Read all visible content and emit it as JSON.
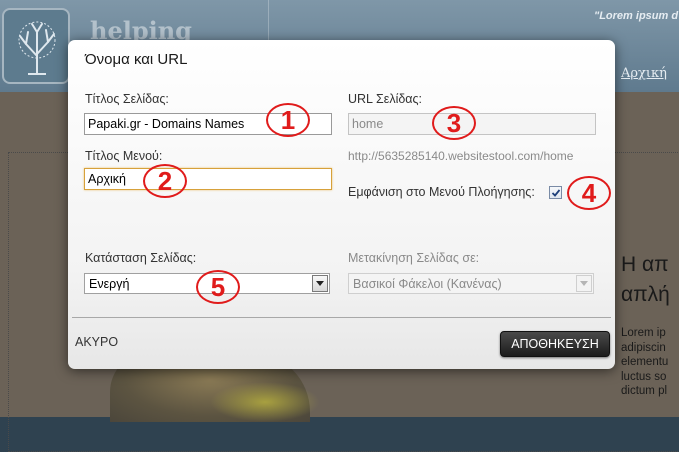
{
  "site": {
    "brand": "helping",
    "tagline": "\"Lorem ipsum d",
    "nav_link": "Αρχική",
    "heading_lines": [
      "Η απ",
      "απλή"
    ],
    "text_lines": [
      "Lorem ip",
      "adipiscin",
      "elementu",
      "luctus so",
      "dictum pl"
    ]
  },
  "dialog": {
    "title": "Όνομα και URL",
    "page_title_label": "Τίτλος Σελίδας:",
    "page_title_value": "Papaki.gr - Domains Names",
    "menu_title_label": "Τίτλος Μενού:",
    "menu_title_value": "Αρχική",
    "url_label": "URL Σελίδας:",
    "url_value": "home",
    "url_preview": "http://5635285140.websitestool.com/home",
    "show_in_menu_label": "Εμφάνιση στο Μενού Πλοήγησης:",
    "show_in_menu_checked": true,
    "status_label": "Κατάσταση Σελίδας:",
    "status_value": "Ενεργή",
    "move_label": "Μετακίνηση Σελίδας σε:",
    "move_value": "Βασικοί Φάκελοι (Κανένας)",
    "cancel_label": "ΑΚΥΡΟ",
    "save_label": "ΑΠΟΘΗΚΕΥΣΗ"
  },
  "markers": [
    "1",
    "2",
    "3",
    "4",
    "5"
  ],
  "colors": {
    "marker": "#e01b1b",
    "focus_border": "#d7a13a",
    "save_button": "#1c1c1c"
  },
  "icons": {
    "logo": "tree-icon",
    "checkbox": "checkmark-icon",
    "select_arrow": "chevron-down-icon"
  }
}
